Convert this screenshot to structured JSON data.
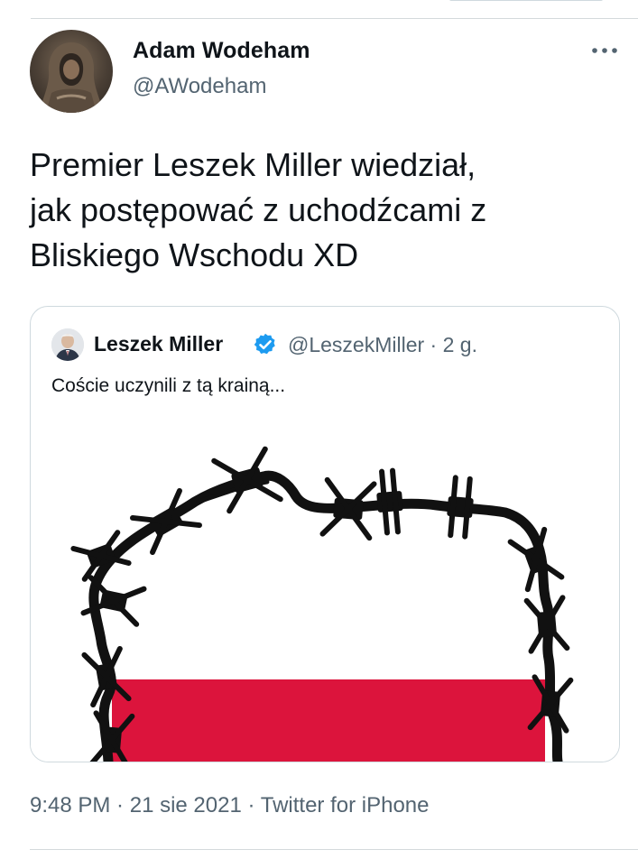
{
  "tweet": {
    "author": {
      "display_name": "Adam Wodeham",
      "handle": "@AWodeham"
    },
    "text_lines": [
      "Premier Leszek Miller wiedział,",
      "jak postępować z uchodźcami z",
      "Bliskiego Wschodu XD"
    ],
    "timestamp": "9:48 PM",
    "separator": " · ",
    "date": "21 sie 2021",
    "source": "Twitter for iPhone"
  },
  "quoted_tweet": {
    "author": {
      "display_name": "Leszek Miller",
      "handle": "@LeszekMiller",
      "verified": true
    },
    "age": "2 g.",
    "text": "Coście uczynili z tą krainą..."
  },
  "icons": {
    "more": "more-horizontal-icon",
    "verified": "verified-badge-icon"
  },
  "colors": {
    "verified_blue": "#1d9bf0",
    "flag_red": "#dc143c",
    "flag_white": "#ffffff",
    "secondary_text": "#536471"
  }
}
